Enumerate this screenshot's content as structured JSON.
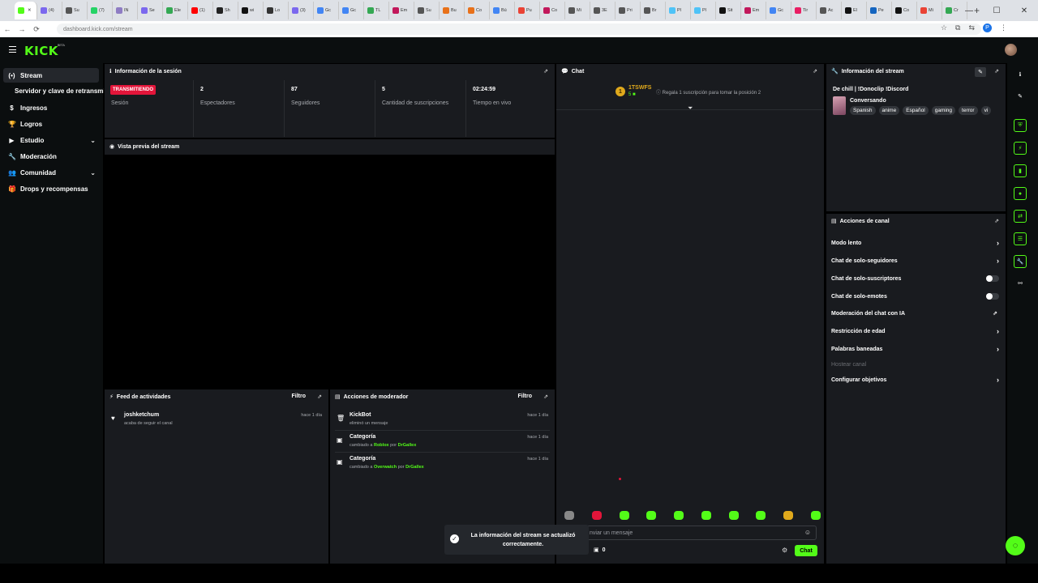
{
  "browser": {
    "url": "dashboard.kick.com/stream",
    "tabs": [
      {
        "label": "",
        "color": "#53fc18",
        "active": true
      },
      {
        "label": "(4)",
        "color": "#7b68ee"
      },
      {
        "label": "Su",
        "color": "#555"
      },
      {
        "label": "(7)",
        "color": "#25d366"
      },
      {
        "label": "IN",
        "color": "#8e7cc3"
      },
      {
        "label": "Se",
        "color": "#7b68ee"
      },
      {
        "label": "Ele",
        "color": "#34a853"
      },
      {
        "label": "(1)",
        "color": "#ff0000"
      },
      {
        "label": "Sh",
        "color": "#222"
      },
      {
        "label": "wi",
        "color": "#111"
      },
      {
        "label": "Lo",
        "color": "#333"
      },
      {
        "label": "(3)",
        "color": "#7b68ee"
      },
      {
        "label": "Gc",
        "color": "#4285f4"
      },
      {
        "label": "Gc",
        "color": "#4285f4"
      },
      {
        "label": "TL",
        "color": "#34a853"
      },
      {
        "label": "Em",
        "color": "#c2185b"
      },
      {
        "label": "Su",
        "color": "#555"
      },
      {
        "label": "Bu",
        "color": "#e8711a"
      },
      {
        "label": "Co",
        "color": "#e8711a"
      },
      {
        "label": "Bú",
        "color": "#4285f4"
      },
      {
        "label": "Pu",
        "color": "#ea4335"
      },
      {
        "label": "Co",
        "color": "#c2185b"
      },
      {
        "label": "Mi",
        "color": "#555"
      },
      {
        "label": "3E",
        "color": "#555"
      },
      {
        "label": "Pri",
        "color": "#555"
      },
      {
        "label": "Br",
        "color": "#555"
      },
      {
        "label": "Pl",
        "color": "#4fc3f7"
      },
      {
        "label": "Pl",
        "color": "#4fc3f7"
      },
      {
        "label": "Sit",
        "color": "#111"
      },
      {
        "label": "Em",
        "color": "#c2185b"
      },
      {
        "label": "Gc",
        "color": "#4285f4"
      },
      {
        "label": "Tir",
        "color": "#e91e63"
      },
      {
        "label": "Ac",
        "color": "#555"
      },
      {
        "label": "El",
        "color": "#111"
      },
      {
        "label": "Pe",
        "color": "#1565c0"
      },
      {
        "label": "Co",
        "color": "#111"
      },
      {
        "label": "Mi",
        "color": "#ea4335"
      },
      {
        "label": "Cr",
        "color": "#34a853"
      }
    ],
    "profile_initial": "P"
  },
  "header": {
    "logo": "KICK",
    "beta": "BETA"
  },
  "sidebar": {
    "items": [
      {
        "label": "Stream",
        "icon": "(•)",
        "active": true
      },
      {
        "label": "Servidor y clave de retransmisión",
        "sub": true
      },
      {
        "label": "Ingresos",
        "icon": "$"
      },
      {
        "label": "Logros",
        "icon": "🏆"
      },
      {
        "label": "Estudio",
        "icon": "▶",
        "chevron": true
      },
      {
        "label": "Moderación",
        "icon": "🔧"
      },
      {
        "label": "Comunidad",
        "icon": "👥",
        "chevron": true
      },
      {
        "label": "Drops y recompensas",
        "icon": "🎁"
      }
    ]
  },
  "session": {
    "title": "Información de la sesión",
    "live_badge": "TRANSMITIENDO",
    "stats": [
      {
        "value": "",
        "label": "Sesión"
      },
      {
        "value": "2",
        "label": "Espectadores"
      },
      {
        "value": "87",
        "label": "Seguidores"
      },
      {
        "value": "5",
        "label": "Cantidad de suscripciones"
      },
      {
        "value": "02:24:59",
        "label": "Tiempo en vivo"
      }
    ]
  },
  "preview": {
    "title": "Vista previa del stream"
  },
  "feed": {
    "title": "Feed de actividades",
    "filter": "Filtro",
    "items": [
      {
        "name": "joshketchum",
        "sub": "acaba de seguir el canal",
        "time": "hace 1 día"
      }
    ]
  },
  "modactions": {
    "title": "Acciones de moderador",
    "filter": "Filtro",
    "items": [
      {
        "name": "KickBot",
        "sub": "eliminó un mensaje",
        "time": "hace 1 día"
      },
      {
        "name": "Categoría",
        "sub_pre": "cambiado a",
        "target": "Roblox",
        "by": "por",
        "mod": "DrGallex",
        "time": "hace 1 día"
      },
      {
        "name": "Categoría",
        "sub_pre": "cambiado a",
        "target": "Overwatch",
        "by": "por",
        "mod": "DrGallex",
        "time": "hace 1 día"
      }
    ]
  },
  "chat": {
    "title": "Chat",
    "sub_rank": "1",
    "sub_name": "1TSWFS",
    "sub_count": "5",
    "gift_text": "Regala 1 suscripción para tomar la posición 2",
    "input_placeholder": "nviar un mensaje",
    "points": "0",
    "send_label": "Chat",
    "emote_colors": [
      "#888",
      "#e3153a",
      "#53fc18",
      "#53fc18",
      "#53fc18",
      "#53fc18",
      "#53fc18",
      "#53fc18",
      "#e0a91c",
      "#53fc18"
    ]
  },
  "toast": {
    "message": "La información del stream se actualizó correctamente."
  },
  "stream_info": {
    "title": "Información del stream",
    "stream_title": "De chill | !Donoclip !Discord",
    "category": "Conversando",
    "tags": [
      "Spanish",
      "anime",
      "Español",
      "gaming",
      "terror",
      "vi"
    ]
  },
  "channel_actions": {
    "title": "Acciones de canal",
    "rows": [
      {
        "label": "Modo lento",
        "control": "chevron"
      },
      {
        "label": "Chat de solo-seguidores",
        "control": "chevron"
      },
      {
        "label": "Chat de solo-suscriptores",
        "control": "toggle"
      },
      {
        "label": "Chat de solo-emotes",
        "control": "toggle"
      },
      {
        "label": "Moderación del chat con IA",
        "control": "external"
      },
      {
        "label": "Restricción de edad",
        "control": "chevron"
      },
      {
        "label": "Palabras baneadas",
        "control": "chevron"
      },
      {
        "label": "Hostear canal",
        "control": "none",
        "disabled": true
      },
      {
        "label": "Configurar objetivos",
        "control": "chevron"
      }
    ]
  },
  "colors": {
    "accent": "#53fc18",
    "live": "#e3153a",
    "panel": "#191b1f",
    "sub_gold": "#e0a91c"
  }
}
